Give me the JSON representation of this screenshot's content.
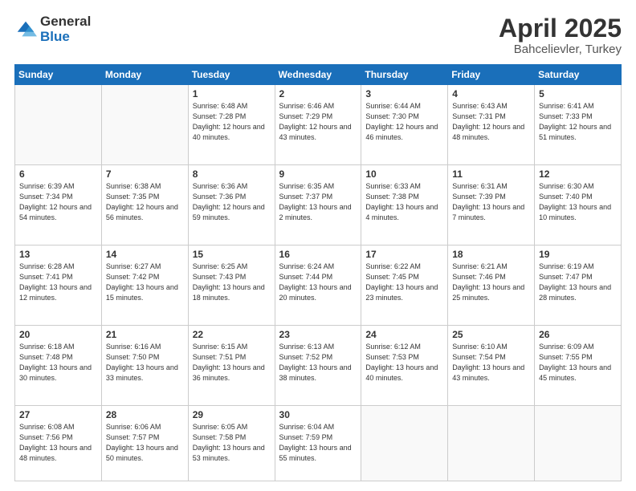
{
  "logo": {
    "general": "General",
    "blue": "Blue"
  },
  "title": {
    "month": "April 2025",
    "location": "Bahcelievler, Turkey"
  },
  "weekdays": [
    "Sunday",
    "Monday",
    "Tuesday",
    "Wednesday",
    "Thursday",
    "Friday",
    "Saturday"
  ],
  "weeks": [
    [
      {
        "day": "",
        "info": ""
      },
      {
        "day": "",
        "info": ""
      },
      {
        "day": "1",
        "info": "Sunrise: 6:48 AM\nSunset: 7:28 PM\nDaylight: 12 hours\nand 40 minutes."
      },
      {
        "day": "2",
        "info": "Sunrise: 6:46 AM\nSunset: 7:29 PM\nDaylight: 12 hours\nand 43 minutes."
      },
      {
        "day": "3",
        "info": "Sunrise: 6:44 AM\nSunset: 7:30 PM\nDaylight: 12 hours\nand 46 minutes."
      },
      {
        "day": "4",
        "info": "Sunrise: 6:43 AM\nSunset: 7:31 PM\nDaylight: 12 hours\nand 48 minutes."
      },
      {
        "day": "5",
        "info": "Sunrise: 6:41 AM\nSunset: 7:33 PM\nDaylight: 12 hours\nand 51 minutes."
      }
    ],
    [
      {
        "day": "6",
        "info": "Sunrise: 6:39 AM\nSunset: 7:34 PM\nDaylight: 12 hours\nand 54 minutes."
      },
      {
        "day": "7",
        "info": "Sunrise: 6:38 AM\nSunset: 7:35 PM\nDaylight: 12 hours\nand 56 minutes."
      },
      {
        "day": "8",
        "info": "Sunrise: 6:36 AM\nSunset: 7:36 PM\nDaylight: 12 hours\nand 59 minutes."
      },
      {
        "day": "9",
        "info": "Sunrise: 6:35 AM\nSunset: 7:37 PM\nDaylight: 13 hours\nand 2 minutes."
      },
      {
        "day": "10",
        "info": "Sunrise: 6:33 AM\nSunset: 7:38 PM\nDaylight: 13 hours\nand 4 minutes."
      },
      {
        "day": "11",
        "info": "Sunrise: 6:31 AM\nSunset: 7:39 PM\nDaylight: 13 hours\nand 7 minutes."
      },
      {
        "day": "12",
        "info": "Sunrise: 6:30 AM\nSunset: 7:40 PM\nDaylight: 13 hours\nand 10 minutes."
      }
    ],
    [
      {
        "day": "13",
        "info": "Sunrise: 6:28 AM\nSunset: 7:41 PM\nDaylight: 13 hours\nand 12 minutes."
      },
      {
        "day": "14",
        "info": "Sunrise: 6:27 AM\nSunset: 7:42 PM\nDaylight: 13 hours\nand 15 minutes."
      },
      {
        "day": "15",
        "info": "Sunrise: 6:25 AM\nSunset: 7:43 PM\nDaylight: 13 hours\nand 18 minutes."
      },
      {
        "day": "16",
        "info": "Sunrise: 6:24 AM\nSunset: 7:44 PM\nDaylight: 13 hours\nand 20 minutes."
      },
      {
        "day": "17",
        "info": "Sunrise: 6:22 AM\nSunset: 7:45 PM\nDaylight: 13 hours\nand 23 minutes."
      },
      {
        "day": "18",
        "info": "Sunrise: 6:21 AM\nSunset: 7:46 PM\nDaylight: 13 hours\nand 25 minutes."
      },
      {
        "day": "19",
        "info": "Sunrise: 6:19 AM\nSunset: 7:47 PM\nDaylight: 13 hours\nand 28 minutes."
      }
    ],
    [
      {
        "day": "20",
        "info": "Sunrise: 6:18 AM\nSunset: 7:48 PM\nDaylight: 13 hours\nand 30 minutes."
      },
      {
        "day": "21",
        "info": "Sunrise: 6:16 AM\nSunset: 7:50 PM\nDaylight: 13 hours\nand 33 minutes."
      },
      {
        "day": "22",
        "info": "Sunrise: 6:15 AM\nSunset: 7:51 PM\nDaylight: 13 hours\nand 36 minutes."
      },
      {
        "day": "23",
        "info": "Sunrise: 6:13 AM\nSunset: 7:52 PM\nDaylight: 13 hours\nand 38 minutes."
      },
      {
        "day": "24",
        "info": "Sunrise: 6:12 AM\nSunset: 7:53 PM\nDaylight: 13 hours\nand 40 minutes."
      },
      {
        "day": "25",
        "info": "Sunrise: 6:10 AM\nSunset: 7:54 PM\nDaylight: 13 hours\nand 43 minutes."
      },
      {
        "day": "26",
        "info": "Sunrise: 6:09 AM\nSunset: 7:55 PM\nDaylight: 13 hours\nand 45 minutes."
      }
    ],
    [
      {
        "day": "27",
        "info": "Sunrise: 6:08 AM\nSunset: 7:56 PM\nDaylight: 13 hours\nand 48 minutes."
      },
      {
        "day": "28",
        "info": "Sunrise: 6:06 AM\nSunset: 7:57 PM\nDaylight: 13 hours\nand 50 minutes."
      },
      {
        "day": "29",
        "info": "Sunrise: 6:05 AM\nSunset: 7:58 PM\nDaylight: 13 hours\nand 53 minutes."
      },
      {
        "day": "30",
        "info": "Sunrise: 6:04 AM\nSunset: 7:59 PM\nDaylight: 13 hours\nand 55 minutes."
      },
      {
        "day": "",
        "info": ""
      },
      {
        "day": "",
        "info": ""
      },
      {
        "day": "",
        "info": ""
      }
    ]
  ]
}
